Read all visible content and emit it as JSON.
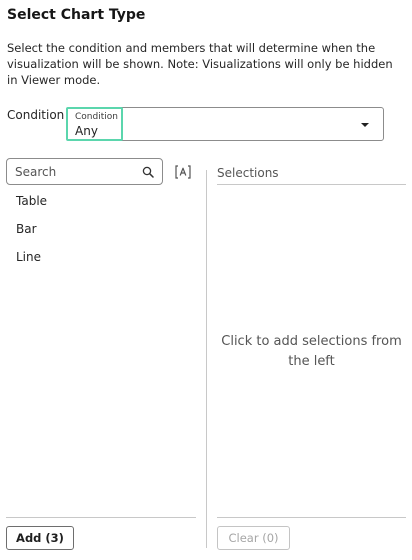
{
  "dialog": {
    "title": "Select Chart Type",
    "description": "Select the condition and members that will determine when the visualization will be shown. Note: Visualizations will only be hidden in Viewer mode."
  },
  "condition": {
    "label": "Condition",
    "field_label": "Condition",
    "value": "Any",
    "icon": "chevron-down-icon"
  },
  "search": {
    "placeholder": "Search",
    "icon": "search-icon",
    "case_toggle_icon": "match-case-icon"
  },
  "members": [
    "Table",
    "Bar",
    "Line"
  ],
  "selections": {
    "header": "Selections",
    "empty_message": "Click to add selections from the left"
  },
  "buttons": {
    "add_label": "Add (3)",
    "clear_label": "Clear (0)"
  },
  "colors": {
    "focus_accent": "#5bd6ad",
    "border": "#8c8c8c",
    "disabled_text": "#a6a6a6"
  }
}
